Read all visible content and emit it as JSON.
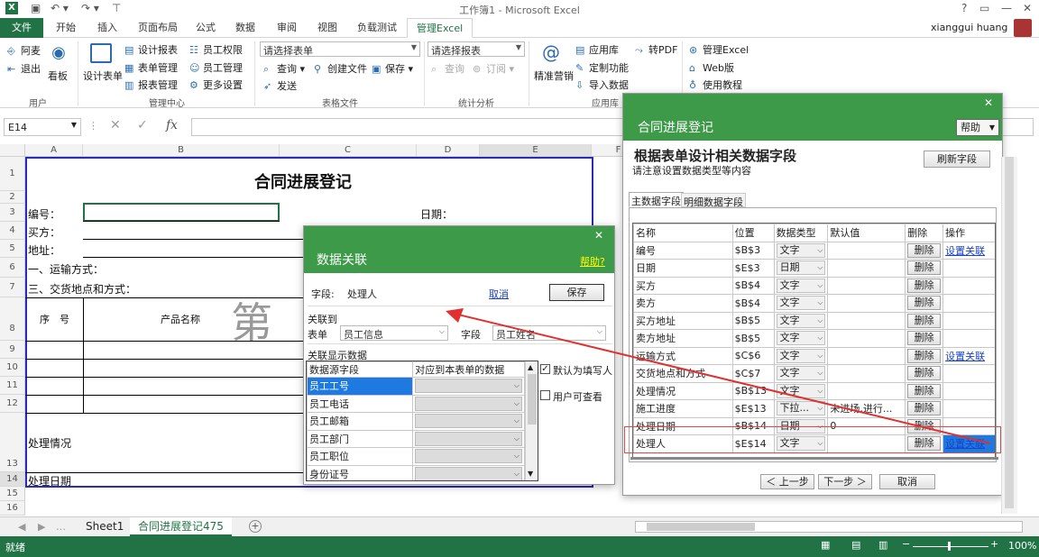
{
  "window": {
    "title": "工作簿1 - Microsoft Excel",
    "user": "xianggui huang",
    "help": "?"
  },
  "tabs": [
    "文件",
    "开始",
    "插入",
    "页面布局",
    "公式",
    "数据",
    "审阅",
    "视图",
    "负载测试",
    "管理Excel"
  ],
  "ribbon": {
    "user_group": {
      "items": [
        "阿麦",
        "退出"
      ],
      "board": "看板",
      "label": "用户"
    },
    "mgmt_group": {
      "design": "设计表单",
      "items": [
        "设计报表",
        "表单管理",
        "报表管理",
        "员工权限",
        "员工管理",
        "更多设置"
      ],
      "label": "管理中心"
    },
    "form_group": {
      "select_form": "请选择表单",
      "items": [
        "查询",
        "创建文件",
        "保存",
        "发送"
      ],
      "label": "表格文件"
    },
    "stat_group": {
      "select_report": "请选择报表",
      "items": [
        "查询",
        "订阅"
      ],
      "label": "统计分析"
    },
    "app_group": {
      "marketing": "精准营销",
      "items": [
        "应用库",
        "定制功能",
        "导入数据",
        "转PDF"
      ],
      "label": "应用库"
    },
    "excel_group": {
      "items": [
        "管理Excel",
        "Web版",
        "使用教程"
      ]
    }
  },
  "formula": {
    "namebox": "E14",
    "fx": "fx"
  },
  "columns": [
    "A",
    "B",
    "C",
    "D",
    "E",
    "F"
  ],
  "rows": [
    "1",
    "2",
    "3",
    "4",
    "5",
    "6",
    "7",
    "8",
    "9",
    "10",
    "11",
    "12",
    "13",
    "14",
    "15",
    "16"
  ],
  "sheet": {
    "title": "合同进展登记",
    "labels": {
      "no": "编号：",
      "date": "日期：",
      "buyer": "买方：",
      "address": "地址：",
      "transport": "一、运输方式：",
      "delivery": "三、交货地点和方式：",
      "seq": "序　号",
      "product": "产品名称",
      "big": "第",
      "status": "处理情况",
      "proc_date": "处理日期"
    }
  },
  "sheet_tabs": [
    "Sheet1",
    "合同进展登记475"
  ],
  "status": {
    "ready": "就绪",
    "zoom": "100%"
  },
  "dlg_main": {
    "title": "合同进展登记",
    "help": "帮助",
    "heading": "根据表单设计相关数据字段",
    "sub": "请注意设置数据类型等内容",
    "refresh": "刷新字段",
    "tabs": [
      "主数据字段",
      "明细数据字段"
    ],
    "headers": [
      "名称",
      "位置",
      "数据类型",
      "默认值",
      "删除",
      "操作"
    ],
    "rows": [
      {
        "name": "编号",
        "pos": "$B$3",
        "type": "文字",
        "def": "",
        "del": "删除",
        "op": "设置关联"
      },
      {
        "name": "日期",
        "pos": "$E$3",
        "type": "日期",
        "def": "",
        "del": "删除",
        "op": ""
      },
      {
        "name": "买方",
        "pos": "$B$4",
        "type": "文字",
        "def": "",
        "del": "删除",
        "op": ""
      },
      {
        "name": "卖方",
        "pos": "$B$4",
        "type": "文字",
        "def": "",
        "del": "删除",
        "op": ""
      },
      {
        "name": "买方地址",
        "pos": "$B$5",
        "type": "文字",
        "def": "",
        "del": "删除",
        "op": ""
      },
      {
        "name": "卖方地址",
        "pos": "$B$5",
        "type": "文字",
        "def": "",
        "del": "删除",
        "op": ""
      },
      {
        "name": "运输方式",
        "pos": "$C$6",
        "type": "文字",
        "def": "",
        "del": "删除",
        "op": "设置关联"
      },
      {
        "name": "交货地点和方式",
        "pos": "$C$7",
        "type": "文字",
        "def": "",
        "del": "删除",
        "op": ""
      },
      {
        "name": "处理情况",
        "pos": "$B$13",
        "type": "文字",
        "def": "",
        "del": "删除",
        "op": ""
      },
      {
        "name": "施工进度",
        "pos": "$E$13",
        "type": "下拉...",
        "def": "未进场,进行...",
        "del": "删除",
        "op": ""
      },
      {
        "name": "处理日期",
        "pos": "$B$14",
        "type": "日期",
        "def": "0",
        "del": "删除",
        "op": ""
      },
      {
        "name": "处理人",
        "pos": "$E$14",
        "type": "文字",
        "def": "",
        "del": "删除",
        "op": "设置关联"
      }
    ],
    "prev": "＜ 上一步",
    "next": "下一步 ＞",
    "cancel": "取消"
  },
  "dlg_link": {
    "title": "数据关联",
    "help": "帮助?",
    "field_label": "字段:",
    "field_value": "处理人",
    "cancel": "取消",
    "save": "保存",
    "link_to": "关联到",
    "form_label": "表单",
    "form_value": "员工信息",
    "field2_label": "字段",
    "field2_value": "员工姓名",
    "display_label": "关联显示数据",
    "col_src": "数据源字段",
    "col_map": "对应到本表单的数据",
    "items": [
      "员工工号",
      "员工电话",
      "员工邮箱",
      "员工部门",
      "员工职位",
      "身份证号"
    ],
    "check1": "默认为填写人",
    "check2": "用户可查看"
  }
}
